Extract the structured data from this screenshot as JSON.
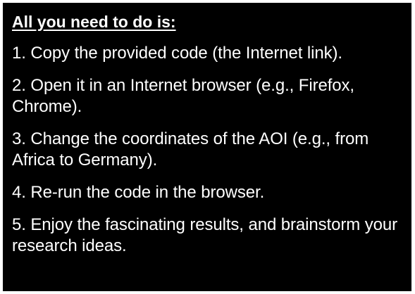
{
  "heading": "All you need to do is:",
  "steps": [
    "1. Copy the provided code (the Internet link).",
    "2. Open it in an Internet browser (e.g., Firefox, Chrome).",
    "3. Change the coordinates of the AOI (e.g., from Africa to Germany).",
    "4. Re-run the code in the browser.",
    "5. Enjoy the fascinating results, and brainstorm your research ideas."
  ],
  "colors": {
    "background": "#000000",
    "text": "#ffffff"
  }
}
